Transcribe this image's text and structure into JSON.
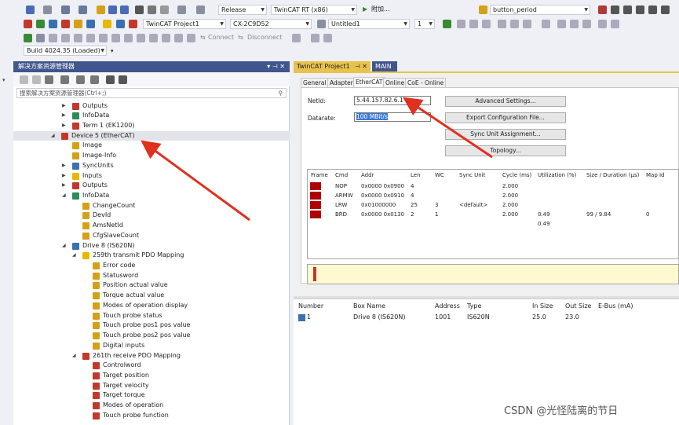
{
  "toolbar1": {
    "config": "Release",
    "platform": "TwinCAT RT (x86)",
    "attach_label": "附加...",
    "find_combo": "button_period"
  },
  "toolbar2": {
    "project": "TwinCAT Project1",
    "target": "CX-2C9D52",
    "file": "Untitled1",
    "num": "1"
  },
  "toolbar3": {
    "connect": "Connect",
    "disconnect": "Disconnect"
  },
  "toolbar4": {
    "build": "Build 4024.35 (Loaded)"
  },
  "explorer": {
    "title": "解决方案资源管理器",
    "pin": "▾ ⊣ ✕",
    "search_placeholder": "搜索解决方案资源管理器(Ctrl+;)",
    "search_icon": "search-icon",
    "items": [
      {
        "label": "Outputs",
        "indent": 0,
        "icon": "#c0392b",
        "tw": "▶"
      },
      {
        "label": "InfoData",
        "indent": 0,
        "icon": "#2e8b57",
        "tw": "▶"
      },
      {
        "label": "Term 1 (EK1200)",
        "indent": 0,
        "icon": "#c0392b",
        "tw": "▶"
      },
      {
        "label": "Device 5 (EtherCAT)",
        "indent": -1,
        "icon": "#c0392b",
        "tw": "◢",
        "selected": true
      },
      {
        "label": "Image",
        "indent": 0,
        "icon": "#d4a017",
        "tw": ""
      },
      {
        "label": "Image-Info",
        "indent": 0,
        "icon": "#d4a017",
        "tw": ""
      },
      {
        "label": "SyncUnits",
        "indent": 0,
        "icon": "#3a6fb0",
        "tw": "▶"
      },
      {
        "label": "Inputs",
        "indent": 0,
        "icon": "#e6b800",
        "tw": "▶"
      },
      {
        "label": "Outputs",
        "indent": 0,
        "icon": "#c0392b",
        "tw": "▶"
      },
      {
        "label": "InfoData",
        "indent": 0,
        "icon": "#2e8b57",
        "tw": "◢"
      },
      {
        "label": "ChangeCount",
        "indent": 1,
        "icon": "#d4a017",
        "tw": ""
      },
      {
        "label": "DevId",
        "indent": 1,
        "icon": "#d4a017",
        "tw": ""
      },
      {
        "label": "AmsNetId",
        "indent": 1,
        "icon": "#d4a017",
        "tw": ""
      },
      {
        "label": "CfgSlaveCount",
        "indent": 1,
        "icon": "#d4a017",
        "tw": ""
      },
      {
        "label": "Drive 8 (IS620N)",
        "indent": 0,
        "icon": "#3a6fb0",
        "tw": "◢"
      },
      {
        "label": "259th transmit PDO Mapping",
        "indent": 1,
        "icon": "#e6b800",
        "tw": "◢"
      },
      {
        "label": "Error code",
        "indent": 2,
        "icon": "#d4a017",
        "tw": ""
      },
      {
        "label": "Statusword",
        "indent": 2,
        "icon": "#d4a017",
        "tw": ""
      },
      {
        "label": "Position actual value",
        "indent": 2,
        "icon": "#d4a017",
        "tw": ""
      },
      {
        "label": "Torque actual value",
        "indent": 2,
        "icon": "#d4a017",
        "tw": ""
      },
      {
        "label": "Modes of operation display",
        "indent": 2,
        "icon": "#d4a017",
        "tw": ""
      },
      {
        "label": "Touch probe status",
        "indent": 2,
        "icon": "#d4a017",
        "tw": ""
      },
      {
        "label": "Touch probe pos1 pos value",
        "indent": 2,
        "icon": "#d4a017",
        "tw": ""
      },
      {
        "label": "Touch probe pos2 pos value",
        "indent": 2,
        "icon": "#d4a017",
        "tw": ""
      },
      {
        "label": "Digital inputs",
        "indent": 2,
        "icon": "#d4a017",
        "tw": ""
      },
      {
        "label": "261th receive PDO Mapping",
        "indent": 1,
        "icon": "#c0392b",
        "tw": "◢"
      },
      {
        "label": "Controlword",
        "indent": 2,
        "icon": "#c0392b",
        "tw": ""
      },
      {
        "label": "Target position",
        "indent": 2,
        "icon": "#c0392b",
        "tw": ""
      },
      {
        "label": "Target velocity",
        "indent": 2,
        "icon": "#c0392b",
        "tw": ""
      },
      {
        "label": "Target torque",
        "indent": 2,
        "icon": "#c0392b",
        "tw": ""
      },
      {
        "label": "Modes of operation",
        "indent": 2,
        "icon": "#c0392b",
        "tw": ""
      },
      {
        "label": "Touch probe function",
        "indent": 2,
        "icon": "#c0392b",
        "tw": ""
      }
    ]
  },
  "doc_tabs": {
    "active": "TwinCAT Project1",
    "pin": "⊣ ✕",
    "other": "MAIN"
  },
  "sub_tabs": [
    "General",
    "Adapter",
    "EtherCAT",
    "Online",
    "CoE - Online"
  ],
  "form": {
    "netid_label": "NetId:",
    "netid_value": "5.44.157.82.6.1",
    "datarate_label": "Datarate:",
    "datarate_value": "100 MBit/s"
  },
  "buttons": {
    "advanced": "Advanced Settings...",
    "export": "Export Configuration File...",
    "sync": "Sync Unit Assignment...",
    "topology": "Topology..."
  },
  "frame_table": {
    "headers": [
      "Frame",
      "Cmd",
      "Addr",
      "Len",
      "WC",
      "Sync Unit",
      "Cycle (ms)",
      "Utilization (%)",
      "Size / Duration (µs)",
      "Map Id"
    ],
    "rows": [
      [
        "",
        "NOP",
        "0x0000 0x0900",
        "4",
        "",
        "",
        "2.000",
        "",
        "",
        ""
      ],
      [
        "",
        "ARMW",
        "0x0000 0x0910",
        "4",
        "",
        "",
        "2.000",
        "",
        "",
        ""
      ],
      [
        "",
        "LRW",
        "0x01000000",
        "25",
        "3",
        "<default>",
        "2.000",
        "",
        "",
        ""
      ],
      [
        "",
        "BRD",
        "0x0000 0x0130",
        "2",
        "1",
        "",
        "2.000",
        "0.49",
        "99 / 9.84",
        "0"
      ],
      [
        "",
        "",
        "",
        "",
        "",
        "",
        "",
        "0.49",
        "",
        ""
      ]
    ]
  },
  "box_list": {
    "headers": [
      "Number",
      "Box Name",
      "Address",
      "Type",
      "In Size",
      "Out Size",
      "E-Bus (mA)"
    ],
    "row": [
      "1",
      "Drive 8 (IS620N)",
      "1001",
      "IS620N",
      "25.0",
      "23.0",
      ""
    ]
  },
  "watermark": "CSDN @光怪陆离的节日"
}
